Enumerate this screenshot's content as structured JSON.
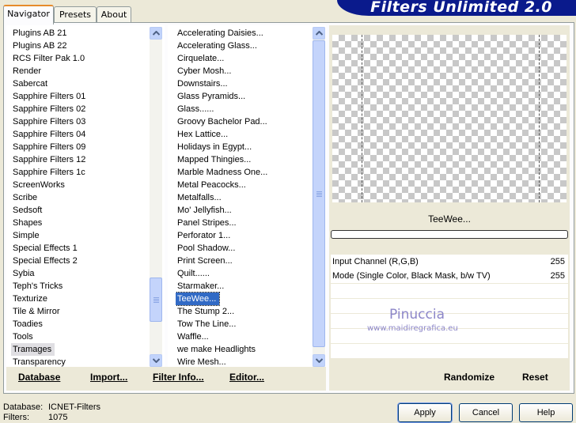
{
  "window_title": "Filters Unlimited 2.0",
  "tabs": [
    "Navigator",
    "Presets",
    "About"
  ],
  "categories": {
    "items": [
      "Plugins AB 21",
      "Plugins AB 22",
      "RCS Filter Pak 1.0",
      "Render",
      "Sabercat",
      "Sapphire Filters 01",
      "Sapphire Filters 02",
      "Sapphire Filters 03",
      "Sapphire Filters 04",
      "Sapphire Filters 09",
      "Sapphire Filters 12",
      "Sapphire Filters 1c",
      "ScreenWorks",
      "Scribe",
      "Sedsoft",
      "Shapes",
      "Simple",
      "Special Effects 1",
      "Special Effects 2",
      "Sybia",
      "Teph's Tricks",
      "Texturize",
      "Tile & Mirror",
      "Toadies",
      "Tools",
      "Tramages",
      "Transparency"
    ],
    "selected": "Tramages"
  },
  "filters": {
    "items": [
      "Accelerating Daisies...",
      "Accelerating Glass...",
      "Cirquelate...",
      "Cyber Mosh...",
      "Downstairs...",
      "Glass Pyramids...",
      "Glass......",
      "Groovy Bachelor Pad...",
      "Hex Lattice...",
      "Holidays in Egypt...",
      "Mapped Thingies...",
      "Marble Madness One...",
      "Metal Peacocks...",
      "Metalfalls...",
      "Mo' Jellyfish...",
      "Panel Stripes...",
      "Perforator 1...",
      "Pool Shadow...",
      "Print Screen...",
      "Quilt......",
      "Starmaker...",
      "TeeWee...",
      "The Stump 2...",
      "Tow The Line...",
      "Waffle...",
      "we make Headlights",
      "Wire Mesh..."
    ],
    "selected": "TeeWee..."
  },
  "preview": {
    "filter_name": "TeeWee..."
  },
  "params": [
    {
      "label": "Input Channel (R,G,B)",
      "value": "255"
    },
    {
      "label": "Mode (Single Color, Black Mask, b/w TV)",
      "value": "255"
    }
  ],
  "watermark": {
    "name": "Pinuccia",
    "url": "www.maidiregrafica.eu"
  },
  "bottom_bar": {
    "database": "Database",
    "import": "Import...",
    "filter_info": "Filter Info...",
    "editor": "Editor...",
    "randomize": "Randomize",
    "reset": "Reset"
  },
  "status": {
    "database_label": "Database:",
    "database_value": "ICNET-Filters",
    "filters_label": "Filters:",
    "filters_value": "1075"
  },
  "buttons": {
    "apply": "Apply",
    "cancel": "Cancel",
    "help": "Help"
  },
  "colors": {
    "title_banner": "#0a1a8c",
    "selection_blue": "#316ac5",
    "watermark": "#8c86c8"
  }
}
